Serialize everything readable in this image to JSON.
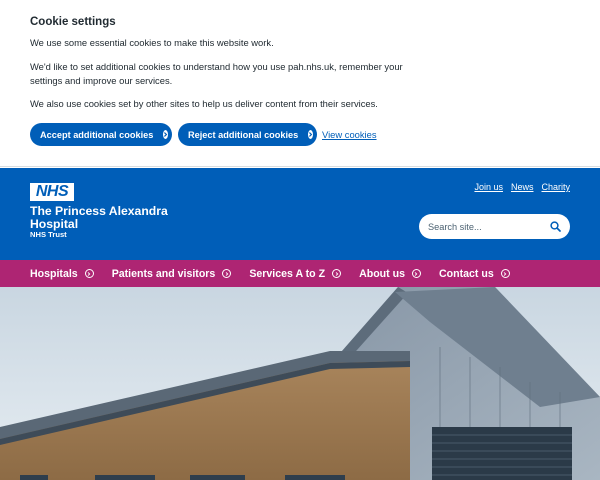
{
  "cookie": {
    "title": "Cookie settings",
    "p1": "We use some essential cookies to make this website work.",
    "p2": "We'd like to set additional cookies to understand how you use pah.nhs.uk, remember your settings and improve our services.",
    "p3": "We also use cookies set by other sites to help us deliver content from their services.",
    "accept_label": "Accept additional cookies",
    "reject_label": "Reject additional cookies",
    "view_label": "View cookies"
  },
  "header": {
    "logo_text": "NHS",
    "org_name_line1": "The Princess Alexandra",
    "org_name_line2": "Hospital",
    "org_sub": "NHS Trust",
    "links": [
      "Join us",
      "News",
      "Charity"
    ],
    "search_placeholder": "Search site..."
  },
  "nav": {
    "items": [
      "Hospitals",
      "Patients and visitors",
      "Services A to Z",
      "About us",
      "Contact us"
    ]
  },
  "colors": {
    "nhs_blue": "#005eb8",
    "nav_pink": "#ae2573",
    "text": "#212b32"
  },
  "icons": {
    "button_chevron": "chevron-right-circle-icon",
    "nav_item": "chevron-circle-icon",
    "search": "magnifier-icon"
  }
}
